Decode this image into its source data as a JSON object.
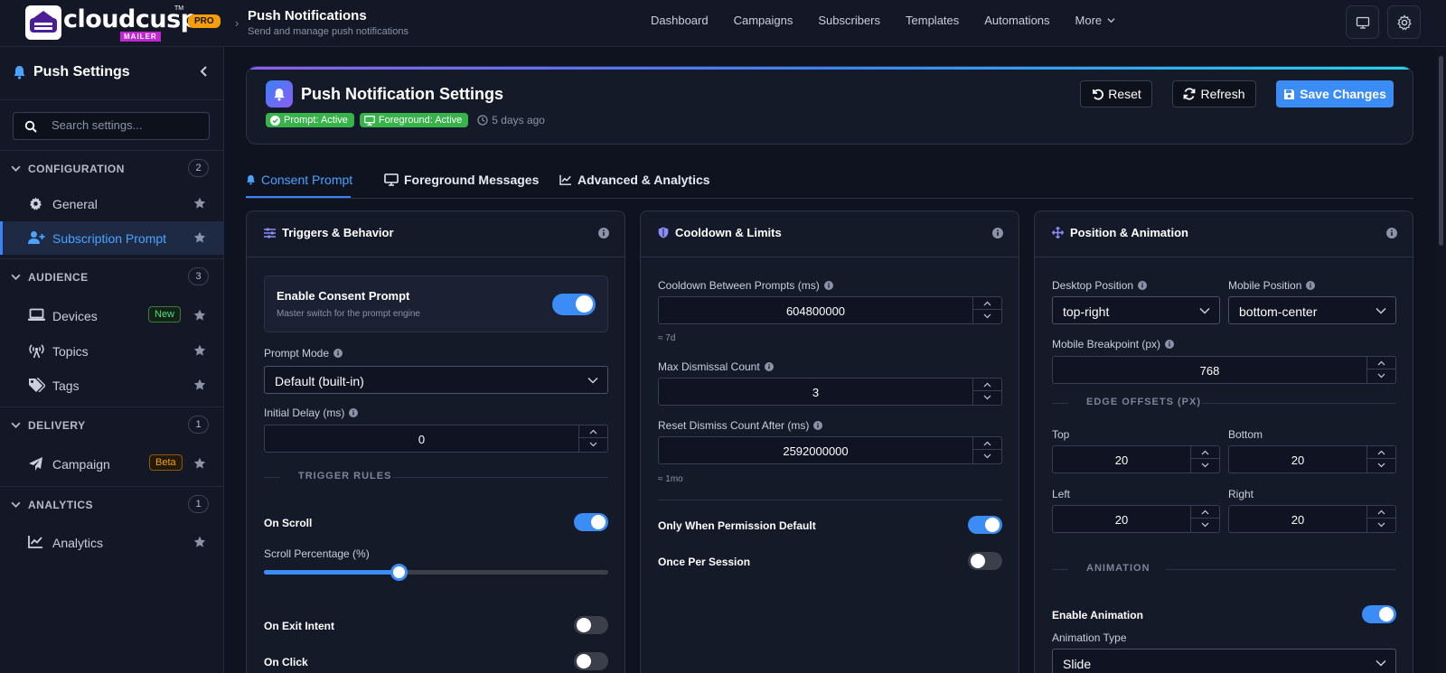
{
  "brand": {
    "name": "cloudcusp",
    "tm": "TM",
    "sub": "MAILER",
    "plan": "PRO"
  },
  "breadcrumb": {
    "sep": "›",
    "title": "Push Notifications",
    "subtitle": "Send and manage push notifications"
  },
  "nav": {
    "items": [
      "Dashboard",
      "Campaigns",
      "Subscribers",
      "Templates",
      "Automations"
    ],
    "more": "More"
  },
  "sidebar": {
    "title": "Push Settings",
    "search_placeholder": "Search settings...",
    "sections": [
      {
        "label": "CONFIGURATION",
        "count": "2",
        "items": [
          {
            "label": "General"
          },
          {
            "label": "Subscription Prompt",
            "active": true
          }
        ]
      },
      {
        "label": "AUDIENCE",
        "count": "3",
        "items": [
          {
            "label": "Devices",
            "tag": "New"
          },
          {
            "label": "Topics"
          },
          {
            "label": "Tags"
          }
        ]
      },
      {
        "label": "DELIVERY",
        "count": "1",
        "items": [
          {
            "label": "Campaign",
            "tag": "Beta"
          }
        ]
      },
      {
        "label": "ANALYTICS",
        "count": "1",
        "items": [
          {
            "label": "Analytics"
          }
        ]
      }
    ]
  },
  "header": {
    "title": "Push Notification Settings",
    "badges": [
      "Prompt: Active",
      "Foreground: Active"
    ],
    "updated": "5 days ago",
    "buttons": {
      "reset": "Reset",
      "refresh": "Refresh",
      "save": "Save Changes"
    }
  },
  "tabs": [
    "Consent Prompt",
    "Foreground Messages",
    "Advanced & Analytics"
  ],
  "triggers": {
    "title": "Triggers & Behavior",
    "enable_title": "Enable Consent Prompt",
    "enable_desc": "Master switch for the prompt engine",
    "enable_on": true,
    "prompt_mode_label": "Prompt Mode",
    "prompt_mode_value": "Default (built-in)",
    "initial_delay_label": "Initial Delay (ms)",
    "initial_delay_value": "0",
    "trigger_rules_label": "TRIGGER RULES",
    "on_scroll_label": "On Scroll",
    "on_scroll": true,
    "scroll_pct_label": "Scroll Percentage (%)",
    "scroll_pct": 0.39,
    "on_exit_label": "On Exit Intent",
    "on_exit": false,
    "on_click_label": "On Click",
    "on_click": false
  },
  "cooldown": {
    "title": "Cooldown & Limits",
    "between_label": "Cooldown Between Prompts (ms)",
    "between_value": "604800000",
    "between_hint": "≈ 7d",
    "max_dismiss_label": "Max Dismissal Count",
    "max_dismiss_value": "3",
    "reset_label": "Reset Dismiss Count After (ms)",
    "reset_value": "2592000000",
    "reset_hint": "≈ 1mo",
    "only_default_label": "Only When Permission Default",
    "only_default": true,
    "once_label": "Once Per Session",
    "once": false
  },
  "position": {
    "title": "Position & Animation",
    "desktop_label": "Desktop Position",
    "desktop_value": "top-right",
    "mobile_label": "Mobile Position",
    "mobile_value": "bottom-center",
    "breakpoint_label": "Mobile Breakpoint (px)",
    "breakpoint_value": "768",
    "offsets_label": "EDGE OFFSETS (PX)",
    "top_label": "Top",
    "top_value": "20",
    "bottom_label": "Bottom",
    "bottom_value": "20",
    "left_label": "Left",
    "left_value": "20",
    "right_label": "Right",
    "right_value": "20",
    "animation_label": "ANIMATION",
    "enable_anim_label": "Enable Animation",
    "enable_anim": true,
    "anim_type_label": "Animation Type",
    "anim_type_value": "Slide"
  },
  "colors": {
    "accent": "#3b8cf5",
    "success": "#38b24a",
    "warning": "#f59e0b",
    "bg": "#0f1320"
  }
}
